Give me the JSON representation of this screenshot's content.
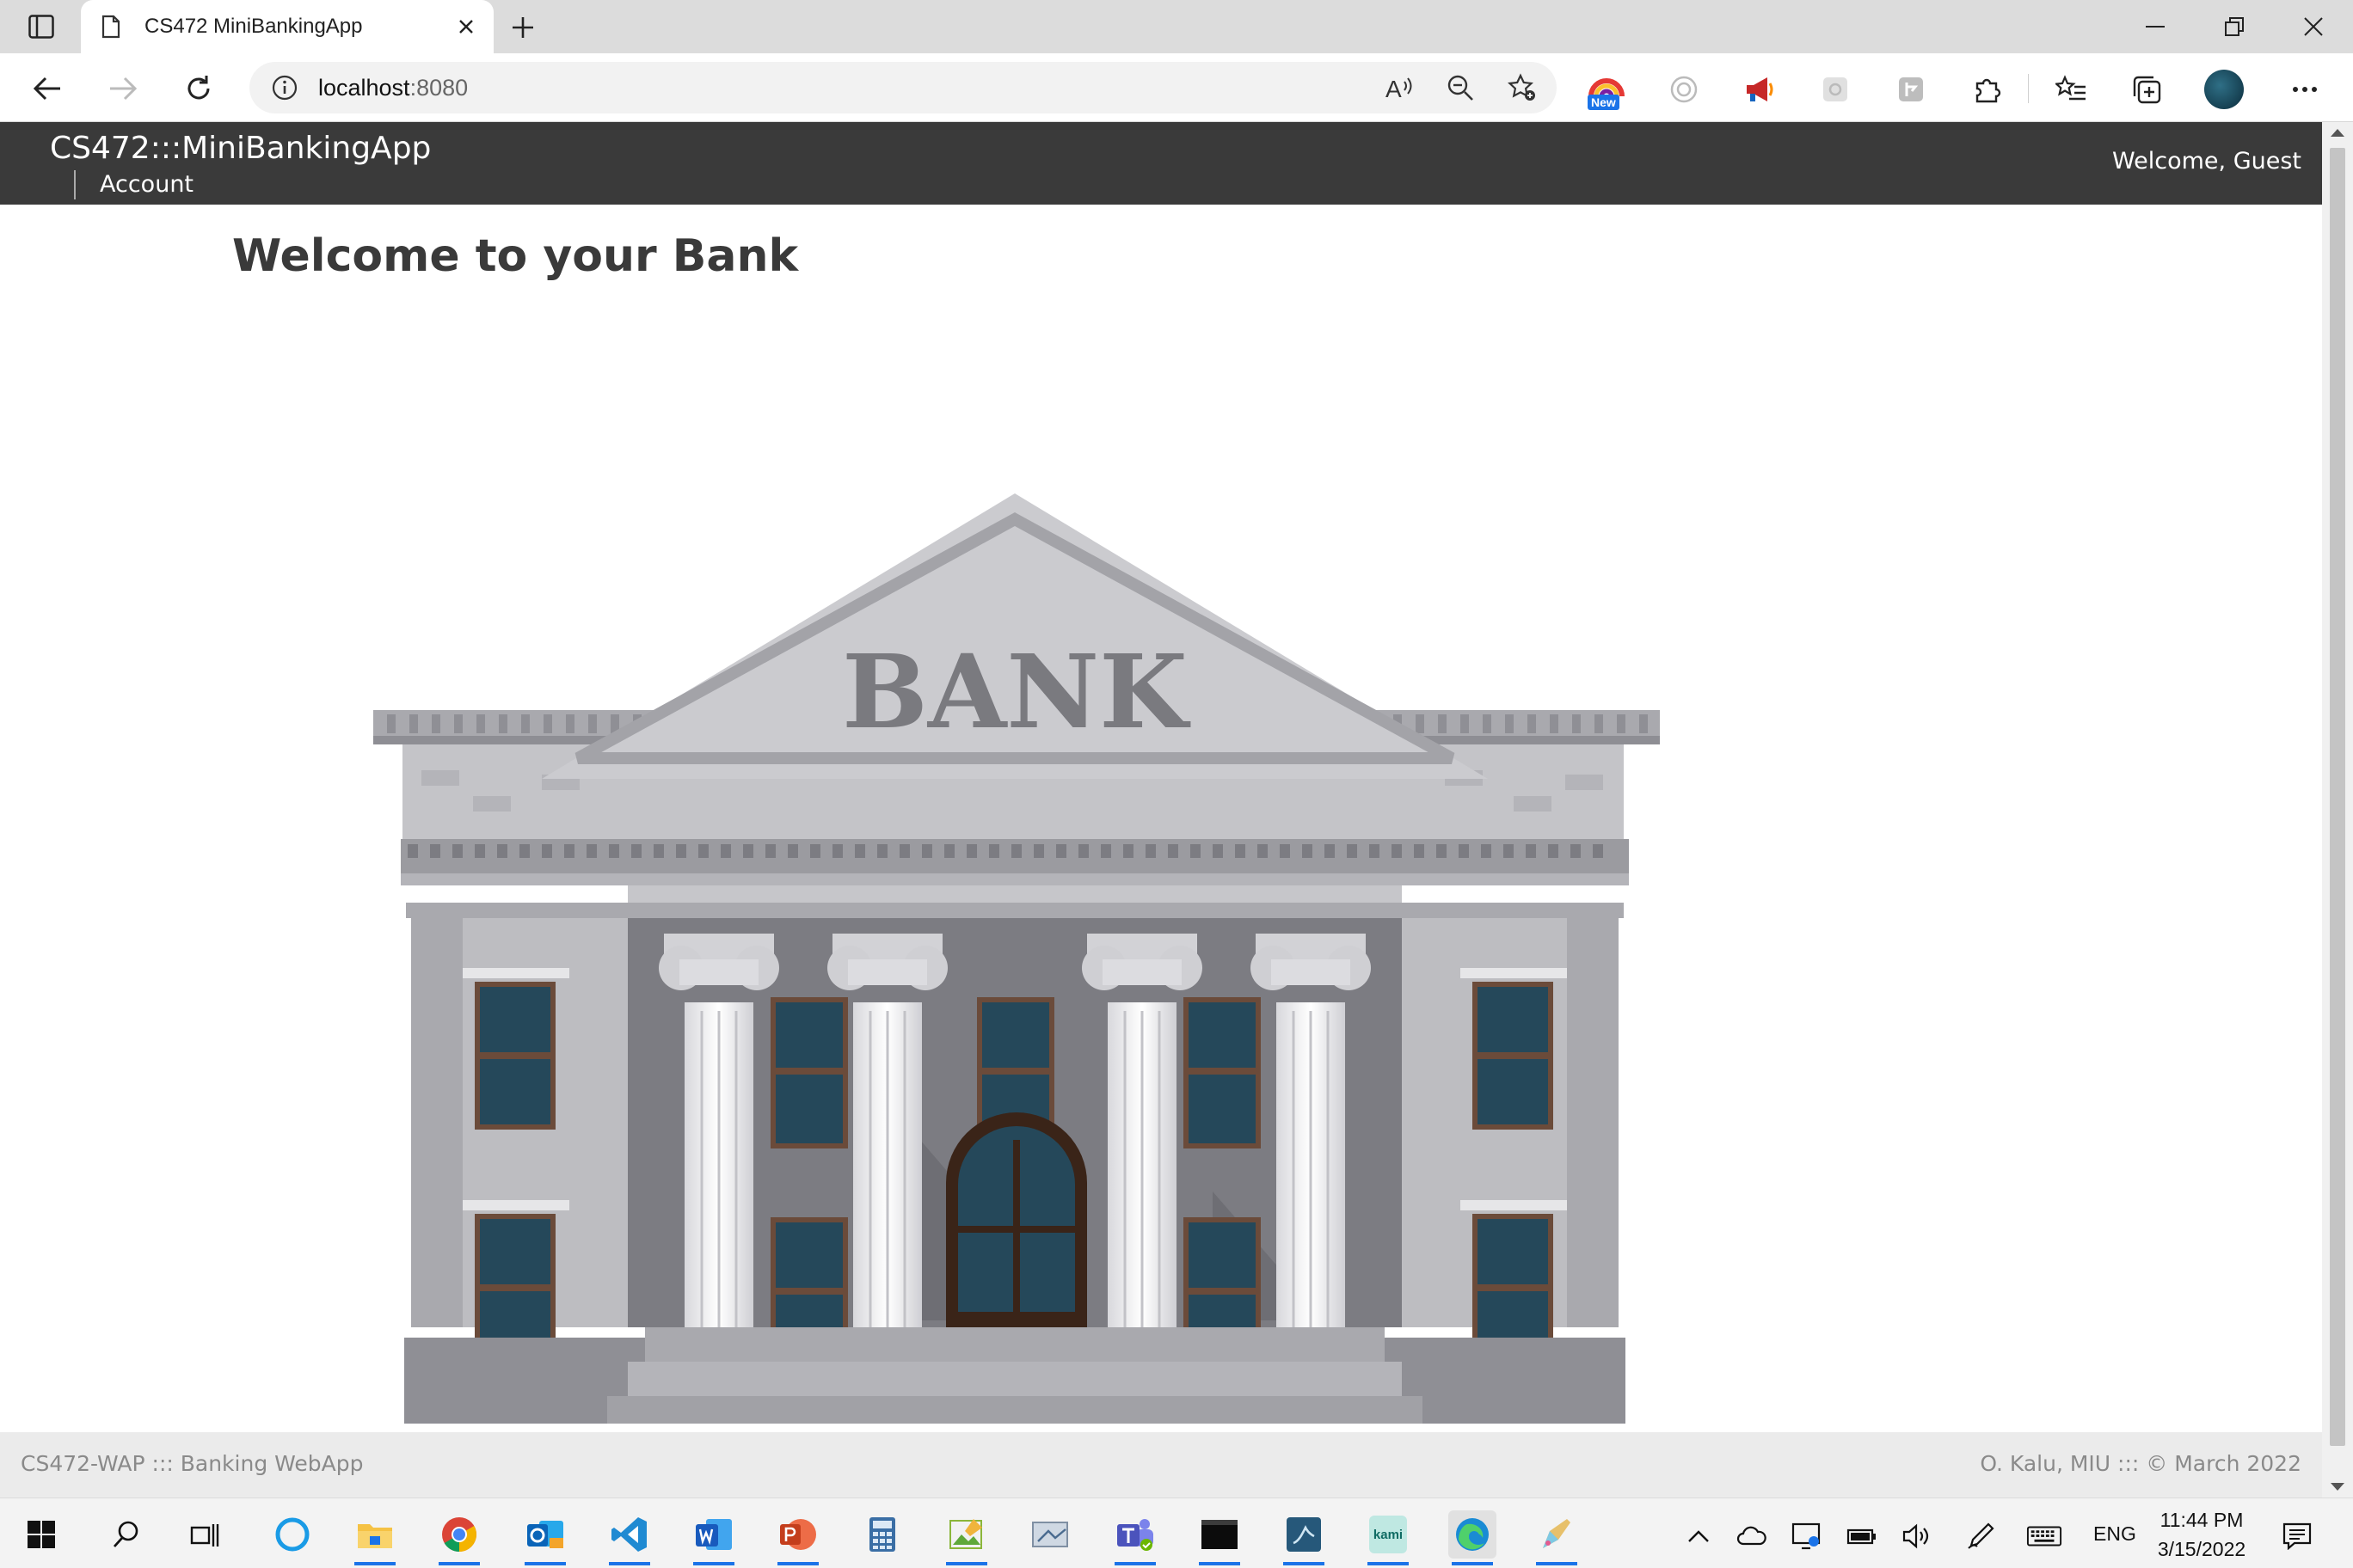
{
  "browser": {
    "tab_title": "CS472 MiniBankingApp",
    "url_host": "localhost",
    "url_port": ":8080",
    "new_badge": "New"
  },
  "app": {
    "brand": "CS472:::MiniBankingApp",
    "nav_items": [
      "Account"
    ],
    "welcome_user": "Welcome, Guest",
    "page_title": "Welcome to your Bank",
    "bank_sign": "BANK",
    "footer_left": "CS472-WAP ::: Banking WebApp",
    "footer_right": "O. Kalu, MIU ::: © March 2022"
  },
  "taskbar": {
    "language": "ENG",
    "time": "11:44 PM",
    "date": "3/15/2022",
    "kami_label": "kami"
  },
  "colors": {
    "header_bg": "#3a3a3a",
    "footer_bg": "#ebebeb",
    "accent": "#1a73e8"
  }
}
